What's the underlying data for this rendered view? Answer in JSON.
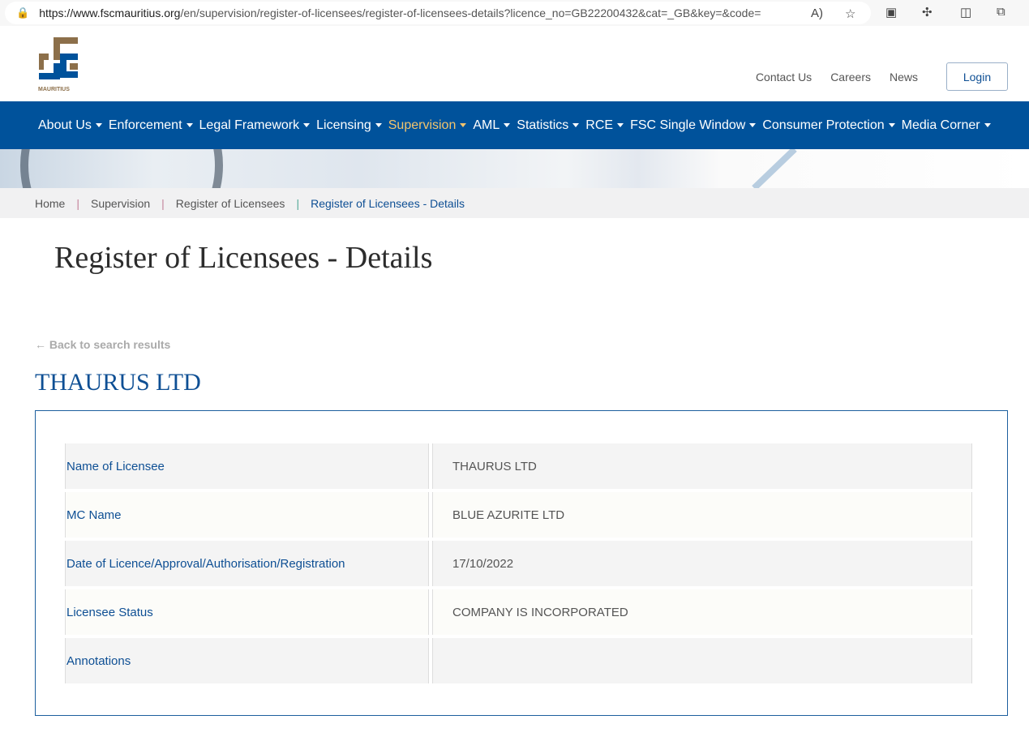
{
  "browser": {
    "url_host": "https://www.fscmauritius.org",
    "url_path": "/en/supervision/register-of-licensees/register-of-licensees-details?licence_no=GB22200432&cat=_GB&key=&code="
  },
  "header": {
    "logo_text": "MAURITIUS",
    "links": [
      "Contact Us",
      "Careers",
      "News"
    ],
    "login": "Login"
  },
  "nav": [
    "About Us",
    "Enforcement",
    "Legal Framework",
    "Licensing",
    "Supervision",
    "AML",
    "Statistics",
    "RCE",
    "FSC Single Window",
    "Consumer Protection",
    "Media Corner"
  ],
  "breadcrumb": [
    "Home",
    "Supervision",
    "Register of Licensees",
    "Register of Licensees - Details"
  ],
  "page_title": "Register of Licensees - Details",
  "back_link": "← Back to search results",
  "company": "THAURUS LTD",
  "details": [
    {
      "label": "Name of Licensee",
      "value": "THAURUS LTD"
    },
    {
      "label": "MC Name",
      "value": "BLUE AZURITE LTD"
    },
    {
      "label": "Date of Licence/Approval/Authorisation/Registration",
      "value": "17/10/2022"
    },
    {
      "label": "Licensee Status",
      "value": "COMPANY IS INCORPORATED"
    },
    {
      "label": "Annotations",
      "value": ""
    }
  ]
}
